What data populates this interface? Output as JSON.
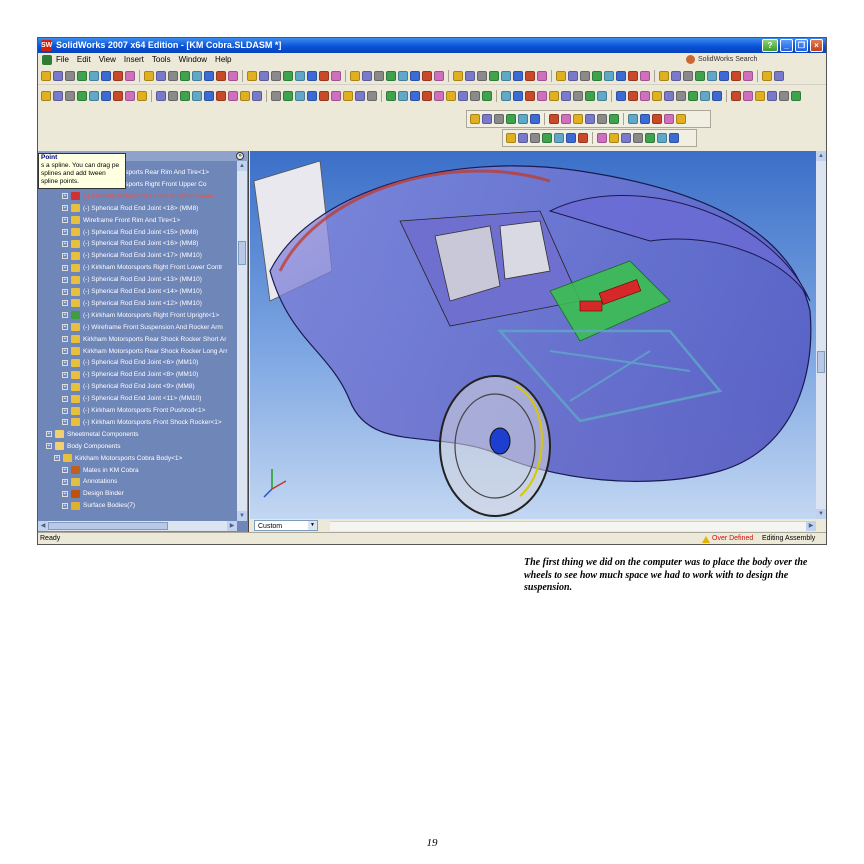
{
  "window": {
    "title": "SolidWorks 2007 x64 Edition - [KM Cobra.SLDASM *]",
    "logo_text": "SW"
  },
  "menu": {
    "items": [
      "File",
      "Edit",
      "View",
      "Insert",
      "Tools",
      "Window",
      "Help"
    ],
    "search_label": "SolidWorks Search"
  },
  "tree": {
    "tooltip_title": "Point",
    "tooltip_body": "s a spline. You can drag pe splines and add tween spline points.",
    "rows": [
      "Kirkham Motorsports Rear Rim And Tire<1>",
      "Kirkham Motorsports Right Front Upper Co",
      "(-) Kirkham Motorsports Front Pushrod Lower",
      "(-) Spherical Rod End Joint <18> (MM8)",
      "Wireframe Front Rim And Tire<1>",
      "(-) Spherical Rod End Joint <15> (MM8)",
      "(-) Spherical Rod End Joint <16> (MM8)",
      "(-) Spherical Rod End Joint <17> (MM10)",
      "(-) Kirkham Motorsports Right Front Lower Contr",
      "(-) Spherical Rod End Joint <13> (MM10)",
      "(-) Spherical Rod End Joint <14> (MM10)",
      "(-) Spherical Rod End Joint <12> (MM10)",
      "(-) Kirkham Motorsports Right Front Upright<1>",
      "(-) Wireframe Front Suspension And Rocker Arm",
      "Kirkham Motorsports Rear Shock Rocker Short Ar",
      "Kirkham Motorsports Rear Shock Rocker Long Arr",
      "(-) Spherical Rod End Joint <6> (MM10)",
      "(-) Spherical Rod End Joint <8> (MM10)",
      "(-) Spherical Rod End Joint <9> (MM8)",
      "(-) Spherical Rod End Joint <11> (MM10)",
      "(-) Kirkham Motorsports Front Pushrod<1>",
      "(-) Kirkham Motorsports Front Shock Rocker<1>",
      "Sheetmetal Components",
      "Body Components",
      "Kirkham Motorsports Cobra Body<1>",
      "Mates in KM Cobra",
      "Annotations",
      "Design Binder",
      "Surface Bodies(7)"
    ]
  },
  "viewport": {
    "view_select": "Custom"
  },
  "status": {
    "ready": "Ready",
    "defined": "Over Defined",
    "mode": "Editing Assembly"
  },
  "caption": "The first thing we did on the computer was to place the body over the wheels to see how much space we had to work with to design the suspension.",
  "page_number": "19"
}
